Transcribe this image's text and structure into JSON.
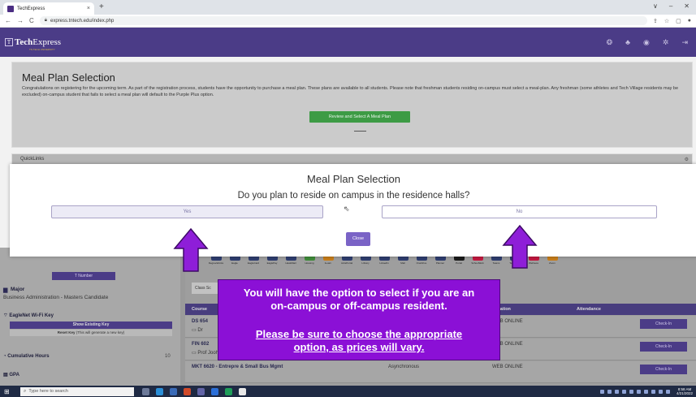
{
  "browser": {
    "tab_title": "TechExpress",
    "tab_close": "×",
    "new_tab": "+",
    "url": "express.tntech.edu/index.php",
    "win_min": "∨",
    "win_max": "–",
    "win_close": "✕"
  },
  "app": {
    "logo_bold": "Tech",
    "logo_rest": "Express",
    "logo_mark": "T",
    "logo_tagline": "TN TECH UNIVERSITY"
  },
  "meal_panel": {
    "title": "Meal Plan Selection",
    "body": "Congratulations on registering for the upcoming term. As part of the registration process, students have the opportunity to purchase a meal plan. These plans are available to all students. Please note that freshman students residing on-campus must select a meal-plan. Any freshman (some athletes and Tech Village residents may be excluded) on-campus student that fails to select a meal plan will default to the Purple Plus option.",
    "review_button": "Review and Select A Meal Plan"
  },
  "quicklinks": {
    "label": "QuickLinks"
  },
  "modal": {
    "title": "Meal Plan Selection",
    "question": "Do you plan to reside on campus in the residence halls?",
    "yes_label": "Yes",
    "no_label": "No",
    "close_label": "Close"
  },
  "sidebar": {
    "t_number": "T Number",
    "major_label": "Major",
    "major_value": "Business Administration - Masters Candidate",
    "wifi_label": "EagleNet Wi-Fi Key",
    "show_key": "Show Existing Key",
    "reset_key_bold": "Reset Key",
    "reset_key_rest": "(This will generate a new key)",
    "cumulative_label": "Cumulative Hours",
    "cumulative_value": "10",
    "gpa_label": "GPA"
  },
  "apps": [
    {
      "name": "DegreeWorks",
      "color": "#2f3d6e"
    },
    {
      "name": "Eagle",
      "color": "#2f3d6e"
    },
    {
      "name": "EagleCard",
      "color": "#2f3d6e"
    },
    {
      "name": "EaglePay",
      "color": "#2f3d6e"
    },
    {
      "name": "HawkMail",
      "color": "#2f3d6e"
    },
    {
      "name": "Housing",
      "color": "#3f8b3a"
    },
    {
      "name": "iLearn",
      "color": "#c77d1a"
    },
    {
      "name": "JobsPortal",
      "color": "#2f3d6e"
    },
    {
      "name": "Library",
      "color": "#2f3d6e"
    },
    {
      "name": "LinkedIn",
      "color": "#2f3d6e"
    },
    {
      "name": "Mail",
      "color": "#2f3d6e"
    },
    {
      "name": "OneDrive",
      "color": "#2f3d6e"
    },
    {
      "name": "Planner",
      "color": "#2f3d6e"
    },
    {
      "name": "Portal",
      "color": "#1a1a1a"
    },
    {
      "name": "SchoolWeb",
      "color": "#c2183f"
    },
    {
      "name": "Teams",
      "color": "#2f3d6e"
    },
    {
      "name": "TechConn",
      "color": "#2f3d6e"
    },
    {
      "name": "Wellness",
      "color": "#c2183f"
    },
    {
      "name": "Zoom",
      "color": "#c77d1a"
    }
  ],
  "classes": {
    "tab_label": "Class Sc",
    "headers": {
      "course": "Course",
      "location": "Location",
      "attendance": "Attendance"
    },
    "rows": [
      {
        "course": "DS 654",
        "prof": "Dr",
        "location": "WEB ONLINE",
        "format": "",
        "checkin": "Check-In"
      },
      {
        "course": "FIN 602",
        "prof": "Prof Joohun Lee",
        "location": "WEB ONLINE",
        "format": "",
        "checkin": "Check-In"
      },
      {
        "course": "MKT 6620 - Entrepre & Small Bus Mgmt",
        "prof": "",
        "location": "WEB ONLINE",
        "format": "Asynchronous",
        "checkin": "Check-In"
      }
    ]
  },
  "callout": {
    "line1": "You will have the option to select if you are an on-campus or off-campus resident.",
    "line2": "Please be sure to choose the appropriate option, as prices will vary."
  },
  "taskbar": {
    "search_placeholder": "Type here to search",
    "clock_time": "8:58 AM",
    "clock_date": "4/21/2022"
  },
  "colors": {
    "brand_purple": "#4b3c87",
    "callout_purple": "#8b10d6",
    "arrow_purple": "#8e1ed8",
    "review_green": "#3d9b45"
  }
}
